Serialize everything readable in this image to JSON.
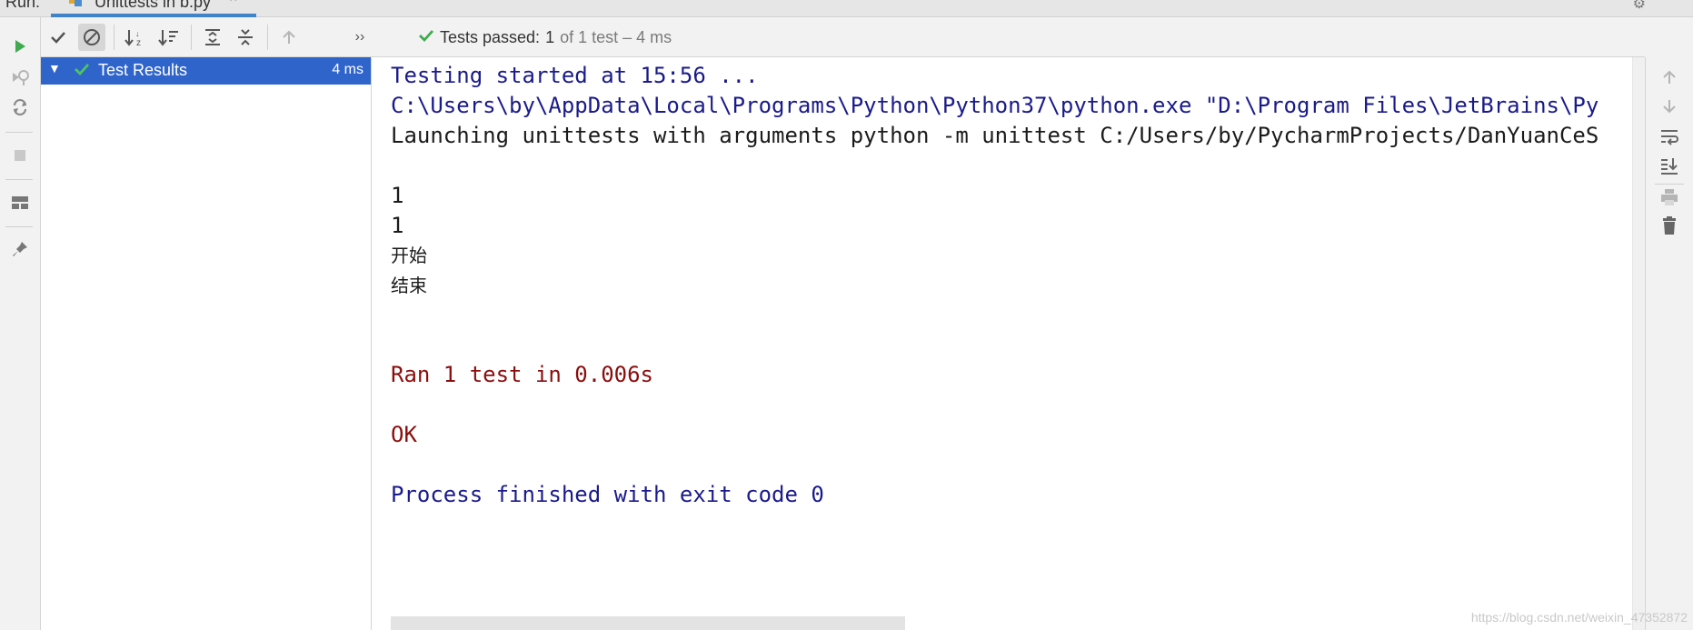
{
  "window": {
    "run_label": "Run:",
    "tab_label": "Unittests in b.py",
    "tab_close": "×"
  },
  "toolbar": {
    "status_passed": "Tests passed:",
    "status_count": "1",
    "status_rest": "of 1 test – 4 ms",
    "more": "››"
  },
  "tree": {
    "arrow": "▼",
    "label": "Test Results",
    "duration": "4 ms"
  },
  "console": {
    "lines": [
      "Testing started at 15:56 ...",
      "C:\\Users\\by\\AppData\\Local\\Programs\\Python\\Python37\\python.exe \"D:\\Program Files\\JetBrains\\Py",
      "Launching unittests with arguments python -m unittest C:/Users/by/PycharmProjects/DanYuanCeS",
      "1",
      "1",
      "开始",
      "结束",
      "Ran 1 test in 0.006s",
      "OK",
      "Process finished with exit code 0"
    ]
  },
  "watermark": "https://blog.csdn.net/weixin_47352872",
  "colors": {
    "accent": "#2f65ca",
    "pass_green": "#3faa4f",
    "console_blue": "#1a1a8c",
    "console_red": "#8b0d0d"
  },
  "icons": [
    "run-icon",
    "rerun-failed-icon",
    "toggle-auto-test-icon",
    "stop-icon",
    "layout-icon",
    "pin-icon",
    "show-passed-icon",
    "show-ignored-icon",
    "sort-alpha-icon",
    "sort-duration-icon",
    "expand-all-icon",
    "collapse-all-icon",
    "previous-failed-icon",
    "scroll-up-icon",
    "scroll-down-icon",
    "soft-wrap-icon",
    "scroll-to-end-icon",
    "print-icon",
    "trash-icon",
    "check-icon"
  ]
}
